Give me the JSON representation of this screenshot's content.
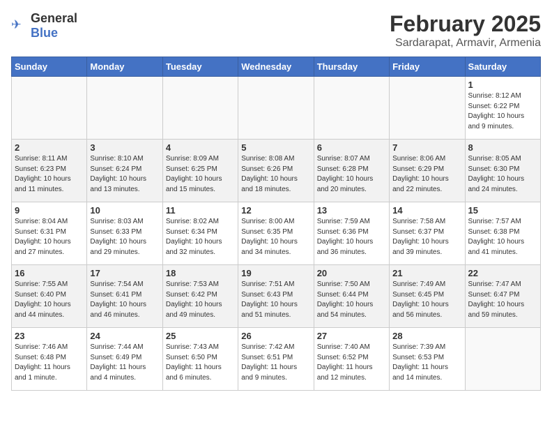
{
  "logo": {
    "text_general": "General",
    "text_blue": "Blue"
  },
  "title": "February 2025",
  "subtitle": "Sardarapat, Armavir, Armenia",
  "weekdays": [
    "Sunday",
    "Monday",
    "Tuesday",
    "Wednesday",
    "Thursday",
    "Friday",
    "Saturday"
  ],
  "weeks": [
    [
      {
        "day": "",
        "info": ""
      },
      {
        "day": "",
        "info": ""
      },
      {
        "day": "",
        "info": ""
      },
      {
        "day": "",
        "info": ""
      },
      {
        "day": "",
        "info": ""
      },
      {
        "day": "",
        "info": ""
      },
      {
        "day": "1",
        "info": "Sunrise: 8:12 AM\nSunset: 6:22 PM\nDaylight: 10 hours\nand 9 minutes."
      }
    ],
    [
      {
        "day": "2",
        "info": "Sunrise: 8:11 AM\nSunset: 6:23 PM\nDaylight: 10 hours\nand 11 minutes."
      },
      {
        "day": "3",
        "info": "Sunrise: 8:10 AM\nSunset: 6:24 PM\nDaylight: 10 hours\nand 13 minutes."
      },
      {
        "day": "4",
        "info": "Sunrise: 8:09 AM\nSunset: 6:25 PM\nDaylight: 10 hours\nand 15 minutes."
      },
      {
        "day": "5",
        "info": "Sunrise: 8:08 AM\nSunset: 6:26 PM\nDaylight: 10 hours\nand 18 minutes."
      },
      {
        "day": "6",
        "info": "Sunrise: 8:07 AM\nSunset: 6:28 PM\nDaylight: 10 hours\nand 20 minutes."
      },
      {
        "day": "7",
        "info": "Sunrise: 8:06 AM\nSunset: 6:29 PM\nDaylight: 10 hours\nand 22 minutes."
      },
      {
        "day": "8",
        "info": "Sunrise: 8:05 AM\nSunset: 6:30 PM\nDaylight: 10 hours\nand 24 minutes."
      }
    ],
    [
      {
        "day": "9",
        "info": "Sunrise: 8:04 AM\nSunset: 6:31 PM\nDaylight: 10 hours\nand 27 minutes."
      },
      {
        "day": "10",
        "info": "Sunrise: 8:03 AM\nSunset: 6:33 PM\nDaylight: 10 hours\nand 29 minutes."
      },
      {
        "day": "11",
        "info": "Sunrise: 8:02 AM\nSunset: 6:34 PM\nDaylight: 10 hours\nand 32 minutes."
      },
      {
        "day": "12",
        "info": "Sunrise: 8:00 AM\nSunset: 6:35 PM\nDaylight: 10 hours\nand 34 minutes."
      },
      {
        "day": "13",
        "info": "Sunrise: 7:59 AM\nSunset: 6:36 PM\nDaylight: 10 hours\nand 36 minutes."
      },
      {
        "day": "14",
        "info": "Sunrise: 7:58 AM\nSunset: 6:37 PM\nDaylight: 10 hours\nand 39 minutes."
      },
      {
        "day": "15",
        "info": "Sunrise: 7:57 AM\nSunset: 6:38 PM\nDaylight: 10 hours\nand 41 minutes."
      }
    ],
    [
      {
        "day": "16",
        "info": "Sunrise: 7:55 AM\nSunset: 6:40 PM\nDaylight: 10 hours\nand 44 minutes."
      },
      {
        "day": "17",
        "info": "Sunrise: 7:54 AM\nSunset: 6:41 PM\nDaylight: 10 hours\nand 46 minutes."
      },
      {
        "day": "18",
        "info": "Sunrise: 7:53 AM\nSunset: 6:42 PM\nDaylight: 10 hours\nand 49 minutes."
      },
      {
        "day": "19",
        "info": "Sunrise: 7:51 AM\nSunset: 6:43 PM\nDaylight: 10 hours\nand 51 minutes."
      },
      {
        "day": "20",
        "info": "Sunrise: 7:50 AM\nSunset: 6:44 PM\nDaylight: 10 hours\nand 54 minutes."
      },
      {
        "day": "21",
        "info": "Sunrise: 7:49 AM\nSunset: 6:45 PM\nDaylight: 10 hours\nand 56 minutes."
      },
      {
        "day": "22",
        "info": "Sunrise: 7:47 AM\nSunset: 6:47 PM\nDaylight: 10 hours\nand 59 minutes."
      }
    ],
    [
      {
        "day": "23",
        "info": "Sunrise: 7:46 AM\nSunset: 6:48 PM\nDaylight: 11 hours\nand 1 minute."
      },
      {
        "day": "24",
        "info": "Sunrise: 7:44 AM\nSunset: 6:49 PM\nDaylight: 11 hours\nand 4 minutes."
      },
      {
        "day": "25",
        "info": "Sunrise: 7:43 AM\nSunset: 6:50 PM\nDaylight: 11 hours\nand 6 minutes."
      },
      {
        "day": "26",
        "info": "Sunrise: 7:42 AM\nSunset: 6:51 PM\nDaylight: 11 hours\nand 9 minutes."
      },
      {
        "day": "27",
        "info": "Sunrise: 7:40 AM\nSunset: 6:52 PM\nDaylight: 11 hours\nand 12 minutes."
      },
      {
        "day": "28",
        "info": "Sunrise: 7:39 AM\nSunset: 6:53 PM\nDaylight: 11 hours\nand 14 minutes."
      },
      {
        "day": "",
        "info": ""
      }
    ]
  ]
}
